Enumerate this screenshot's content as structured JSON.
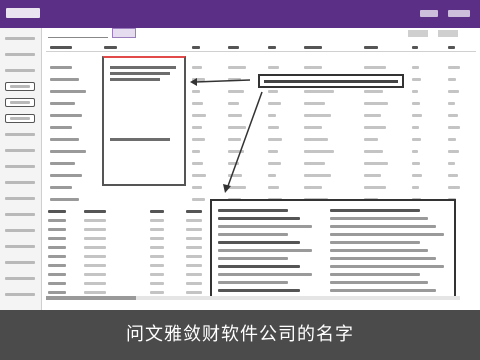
{
  "caption": {
    "text": "问文雅敛财软件公司的名字"
  },
  "sidebar": {
    "items": [
      {
        "selected": false
      },
      {
        "selected": false
      },
      {
        "selected": false
      },
      {
        "selected": true
      },
      {
        "selected": true
      },
      {
        "selected": true
      },
      {
        "selected": false
      },
      {
        "selected": false
      },
      {
        "selected": false
      },
      {
        "selected": false
      },
      {
        "selected": false
      },
      {
        "selected": false
      },
      {
        "selected": false
      },
      {
        "selected": false
      },
      {
        "selected": false
      },
      {
        "selected": false
      },
      {
        "selected": false
      }
    ]
  },
  "colors": {
    "title_bar": "#5b2f86",
    "highlight_border": "#e24a4a",
    "caption_bg": "#3c3c3c"
  }
}
